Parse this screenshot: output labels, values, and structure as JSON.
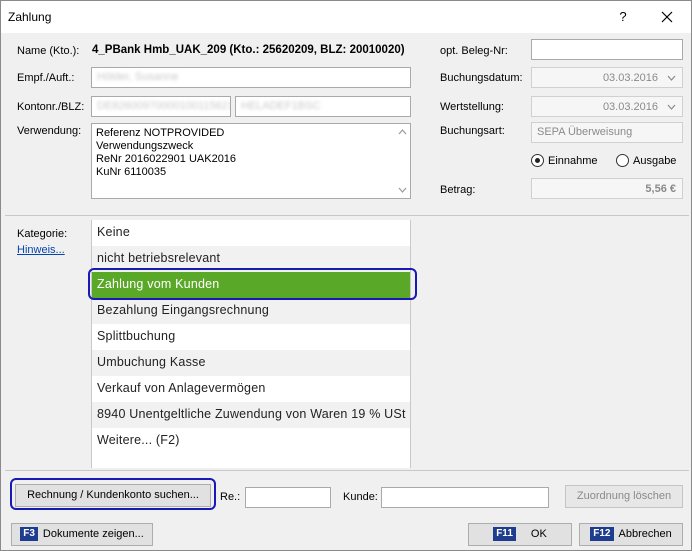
{
  "window": {
    "title": "Zahlung",
    "help": "?"
  },
  "header": {
    "name_label": "Name (Kto.):",
    "name_value": "4_PBank Hmb_UAK_209 (Kto.: 25620209, BLZ: 20010020)",
    "empf_label": "Empf./Auft.:",
    "empf_value": "Hölder, Susanne",
    "kontonr_label": "Kontonr./BLZ:",
    "kontonr_value": "DE82600970000100115621",
    "blz_value": "HELADEF1BSC",
    "verwendung_label": "Verwendung:",
    "verwendung_lines": [
      "Referenz NOTPROVIDED",
      "Verwendungszweck",
      "ReNr 2016022901 UAK2016",
      "KuNr 6110035"
    ],
    "beleg_label": "opt. Beleg-Nr:",
    "beleg_value": "",
    "buchungsdatum_label": "Buchungsdatum:",
    "buchungsdatum_value": "03.03.2016",
    "wertstellung_label": "Wertstellung:",
    "wertstellung_value": "03.03.2016",
    "buchungsart_label": "Buchungsart:",
    "buchungsart_value": "SEPA Überweisung",
    "einnahme_label": "Einnahme",
    "ausgabe_label": "Ausgabe",
    "direction_selected": "Einnahme",
    "betrag_label": "Betrag:",
    "betrag_value": "5,56 €"
  },
  "category": {
    "label": "Kategorie:",
    "hint_link": "Hinweis...",
    "items": [
      "Keine",
      "nicht betriebsrelevant",
      "Zahlung vom Kunden",
      "Bezahlung Eingangsrechnung",
      "Splittbuchung",
      "Umbuchung Kasse",
      "Verkauf von Anlagevermögen",
      "8940 Unentgeltliche Zuwendung von Waren 19 % USt",
      "Weitere... (F2)"
    ],
    "selected": "Zahlung vom Kunden"
  },
  "assign": {
    "search_button": "Rechnung / Kundenkonto suchen...",
    "re_label": "Re.:",
    "re_value": "",
    "kunde_label": "Kunde:",
    "kunde_value": "",
    "clear_button": "Zuordnung löschen"
  },
  "footer": {
    "docs_key": "F3",
    "docs_label": "Dokumente zeigen...",
    "ok_key": "F11",
    "ok_label": "OK",
    "cancel_key": "F12",
    "cancel_label": "Abbrechen"
  },
  "colors": {
    "selected_bg": "#5aa827",
    "highlight_border": "#1919b8",
    "key_badge": "#1f3d8f"
  }
}
